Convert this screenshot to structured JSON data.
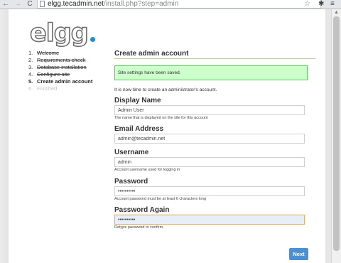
{
  "browser": {
    "url_host": "elgg.tecadmin.net",
    "url_path": "/install.php?step=admin"
  },
  "logo_text": "elgg",
  "steps": [
    {
      "num": "1.",
      "label": "Welcome",
      "state": "done"
    },
    {
      "num": "2.",
      "label": "Requirements check",
      "state": "done"
    },
    {
      "num": "3.",
      "label": "Database installation",
      "state": "done"
    },
    {
      "num": "4.",
      "label": "Configure site",
      "state": "done"
    },
    {
      "num": "5.",
      "label": "Create admin account",
      "state": "current"
    },
    {
      "num": "6.",
      "label": "Finished",
      "state": "pending"
    }
  ],
  "form": {
    "title": "Create admin account",
    "success_message": "Site settings have been saved.",
    "intro": "It is now time to create an administrator's account.",
    "fields": {
      "display_name": {
        "label": "Display Name",
        "value": "Admin User",
        "help": "The name that is displayed on the site for this account"
      },
      "email": {
        "label": "Email Address",
        "value": "admin@tecadmin.net",
        "help": ""
      },
      "username": {
        "label": "Username",
        "value": "admin",
        "help": "Account username used for logging in"
      },
      "password": {
        "label": "Password",
        "value": "••••••••••",
        "help": "Account password must be at least 6 characters long"
      },
      "password_again": {
        "label": "Password Again",
        "value": "••••••••••",
        "help": "Retype password to confirm."
      }
    },
    "next_label": "Next"
  },
  "colors": {
    "accent": "#4b90d4",
    "success_bg": "#ccffcc",
    "success_border": "#55cc55",
    "page_bg": "#2a5faa"
  }
}
